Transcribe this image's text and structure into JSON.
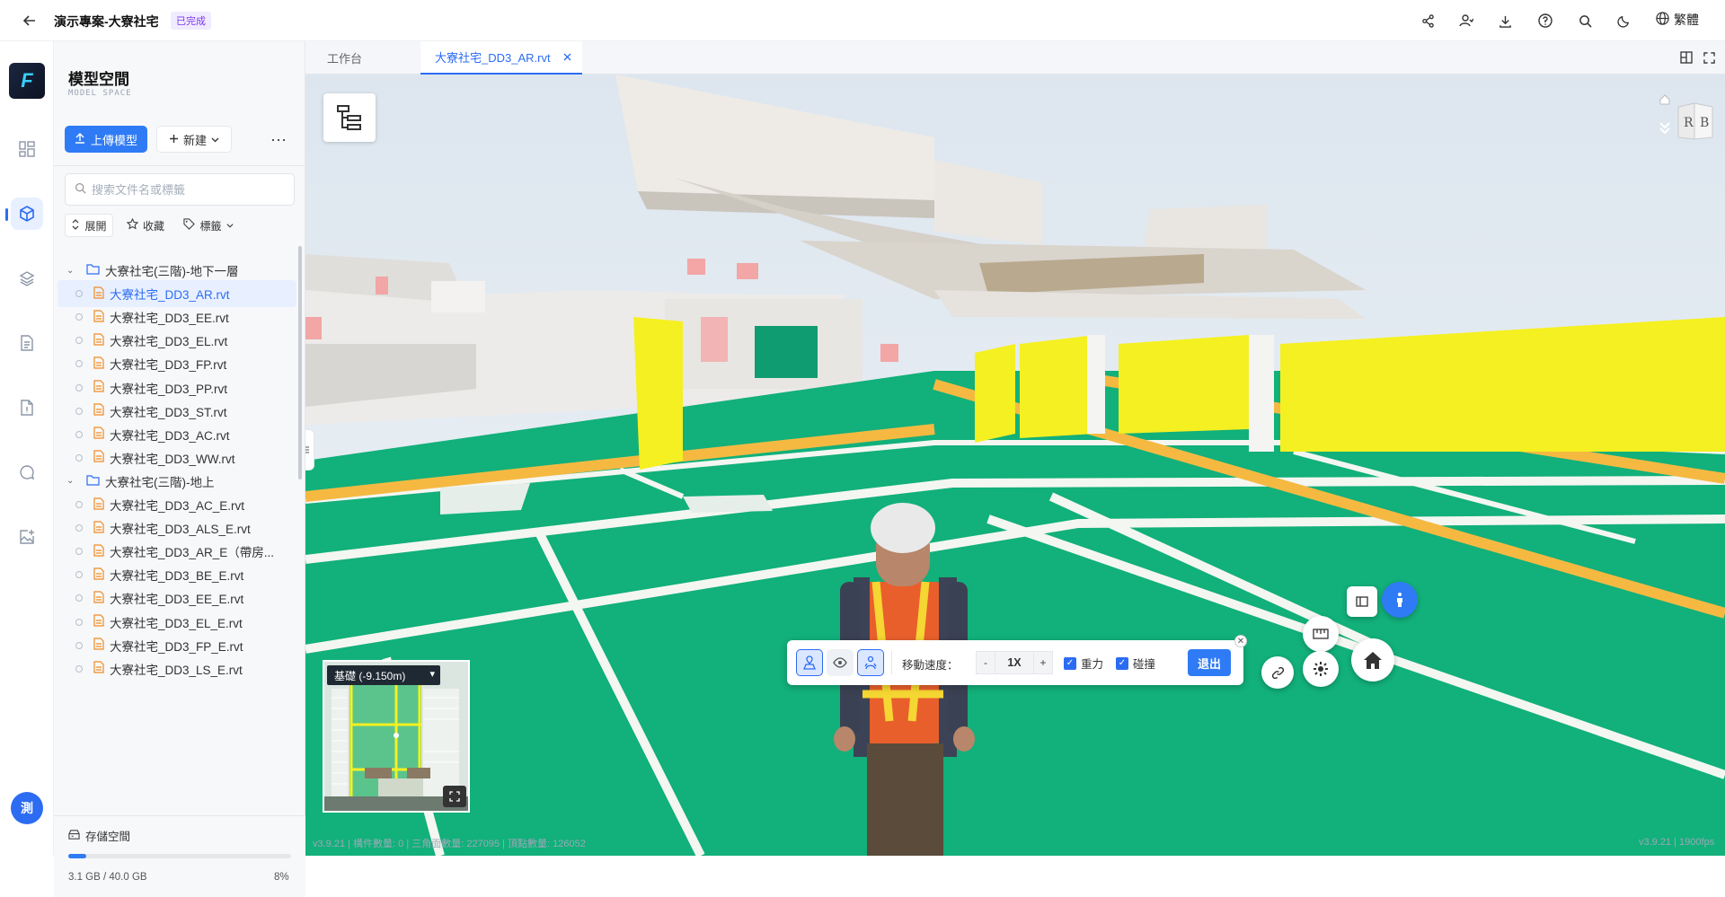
{
  "header": {
    "back_icon": "arrow-left-icon",
    "project_title": "演示專案-大寮社宅",
    "status_badge": "已完成",
    "icons": [
      "share-icon",
      "member-icon",
      "download-icon",
      "help-icon",
      "search-icon",
      "dark-mode-icon",
      "globe-icon"
    ],
    "language": "繁體"
  },
  "rail": {
    "logo": "F",
    "items": [
      "dashboard-icon",
      "model-cube-icon",
      "layers-icon",
      "document-icon",
      "file-report-icon",
      "chat-icon",
      "image-add-icon"
    ],
    "active_index": 1,
    "user_initial": "測"
  },
  "panel": {
    "title": "模型空間",
    "subtitle": "MODEL SPACE",
    "upload_label": "上傳模型",
    "new_label": "新建",
    "more_label": "···",
    "search_placeholder": "搜索文件名或標籤",
    "chips": {
      "expand": "展開",
      "favorite": "收藏",
      "tag": "標籤"
    },
    "tree": [
      {
        "type": "folder",
        "label": "大寮社宅(三階)-地下一層"
      },
      {
        "type": "file",
        "label": "大寮社宅_DD3_AR.rvt",
        "selected": true
      },
      {
        "type": "file",
        "label": "大寮社宅_DD3_EE.rvt"
      },
      {
        "type": "file",
        "label": "大寮社宅_DD3_EL.rvt"
      },
      {
        "type": "file",
        "label": "大寮社宅_DD3_FP.rvt"
      },
      {
        "type": "file",
        "label": "大寮社宅_DD3_PP.rvt"
      },
      {
        "type": "file",
        "label": "大寮社宅_DD3_ST.rvt"
      },
      {
        "type": "file",
        "label": "大寮社宅_DD3_AC.rvt"
      },
      {
        "type": "file",
        "label": "大寮社宅_DD3_WW.rvt"
      },
      {
        "type": "folder",
        "label": "大寮社宅(三階)-地上"
      },
      {
        "type": "file",
        "label": "大寮社宅_DD3_AC_E.rvt"
      },
      {
        "type": "file",
        "label": "大寮社宅_DD3_ALS_E.rvt"
      },
      {
        "type": "file",
        "label": "大寮社宅_DD3_AR_E（帶房..."
      },
      {
        "type": "file",
        "label": "大寮社宅_DD3_BE_E.rvt"
      },
      {
        "type": "file",
        "label": "大寮社宅_DD3_EE_E.rvt"
      },
      {
        "type": "file",
        "label": "大寮社宅_DD3_EL_E.rvt"
      },
      {
        "type": "file",
        "label": "大寮社宅_DD3_FP_E.rvt"
      },
      {
        "type": "file",
        "label": "大寮社宅_DD3_LS_E.rvt"
      }
    ],
    "storage": {
      "label": "存儲空間",
      "used": "3.1 GB / 40.0 GB",
      "percent": "8%",
      "fraction": 0.08
    }
  },
  "tabs": [
    {
      "label": "工作台",
      "active": false
    },
    {
      "label": "大寮社宅_DD3_AR.rvt",
      "active": true,
      "closable": true
    }
  ],
  "viewport": {
    "viewcube": {
      "left_face": "R",
      "right_face": "B"
    },
    "minimap": {
      "level": "基礎 (-9.150m)"
    },
    "stats": "v3.9.21 | 構件數量: 0 | 三角面數量: 227095 | 頂點數量: 126052",
    "version": "v3.9.21 | 1900fps",
    "walk_toolbar": {
      "speed_label": "移動速度：",
      "minus": "-",
      "speed_value": "1X",
      "plus": "+",
      "gravity_label": "重力",
      "gravity_checked": true,
      "collision_label": "碰撞",
      "collision_checked": true,
      "exit_label": "退出"
    },
    "colors": {
      "floor": "#12b07a",
      "accent": "#2c6cf3",
      "wall_yellow": "#f5f021"
    }
  }
}
